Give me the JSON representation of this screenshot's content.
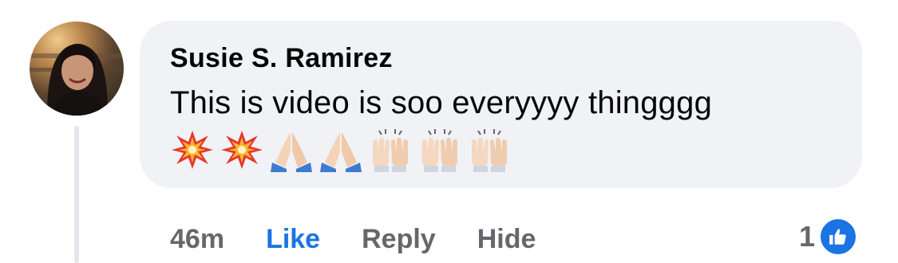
{
  "comment": {
    "author": "Susie S. Ramirez",
    "text": "This is video is soo everyyyy thingggg",
    "emojis": [
      "collision-icon",
      "collision-icon",
      "folded-hands-icon",
      "folded-hands-icon",
      "raising-hands-icon",
      "raising-hands-icon",
      "raising-hands-icon"
    ]
  },
  "actions": {
    "timestamp": "46m",
    "like_label": "Like",
    "reply_label": "Reply",
    "hide_label": "Hide"
  },
  "reactions": {
    "count": "1",
    "type": "like-icon"
  },
  "colors": {
    "accent": "#1b74e4",
    "bubble": "#f0f2f5",
    "muted_text": "#65676b",
    "text": "#050505"
  }
}
